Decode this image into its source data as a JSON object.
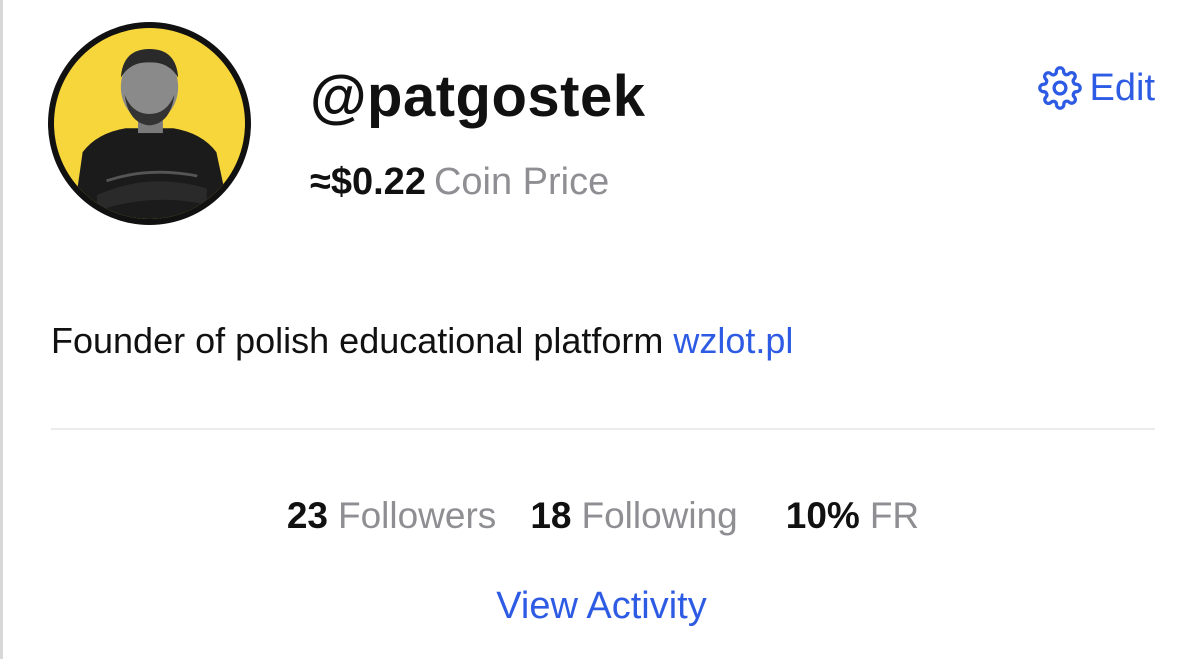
{
  "profile": {
    "handle": "@patgostek",
    "coin_value": "≈$0.22",
    "coin_label": "Coin Price",
    "avatar_bg": "#f6d63a"
  },
  "edit": {
    "icon": "gear-icon",
    "label": "Edit"
  },
  "bio": {
    "text": "Founder of polish educational platform ",
    "link": "wzlot.pl"
  },
  "stats": [
    {
      "value": "23",
      "label": "Followers"
    },
    {
      "value": "18",
      "label": "Following"
    },
    {
      "value": "10%",
      "label": "FR"
    }
  ],
  "view_activity": "View Activity",
  "colors": {
    "accent": "#2d5be3",
    "muted": "#8e8e93",
    "text": "#111111"
  }
}
